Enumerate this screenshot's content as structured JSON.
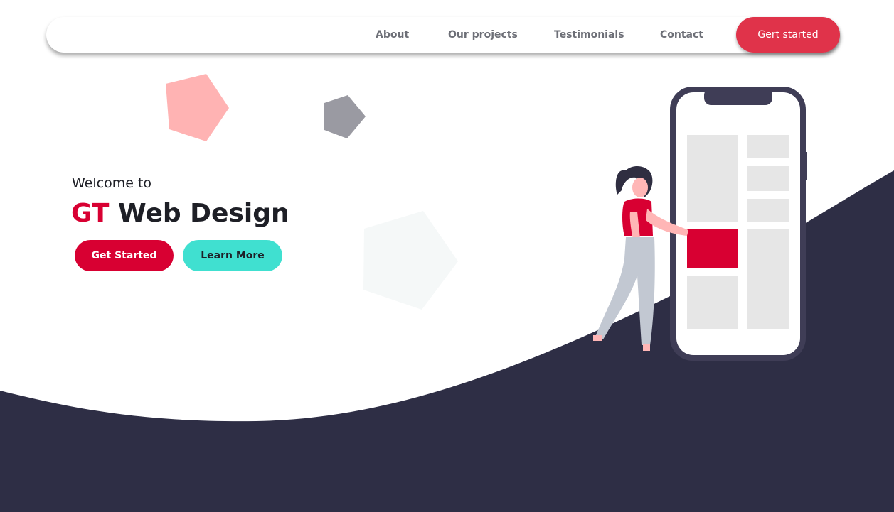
{
  "nav": {
    "links": [
      "About",
      "Our projects",
      "Testimonials",
      "Contact"
    ],
    "cta": "Gert started"
  },
  "hero": {
    "kicker": "Welcome to",
    "title_accent": "GT",
    "title_rest": "Web Design",
    "primary_button": "Get Started",
    "secondary_button": "Learn More"
  },
  "colors": {
    "accent": "#d80032",
    "nav_cta": "#e0334a",
    "teal": "#40e0d0",
    "dark": "#2e2e45",
    "pink_shape": "#ffb3b3",
    "gray_shape": "#9a9aa2"
  },
  "icons": {
    "illustration": "woman-with-phone-illustration",
    "decor": [
      "pentagon-pink",
      "pentagon-gray",
      "pentagon-light"
    ]
  }
}
